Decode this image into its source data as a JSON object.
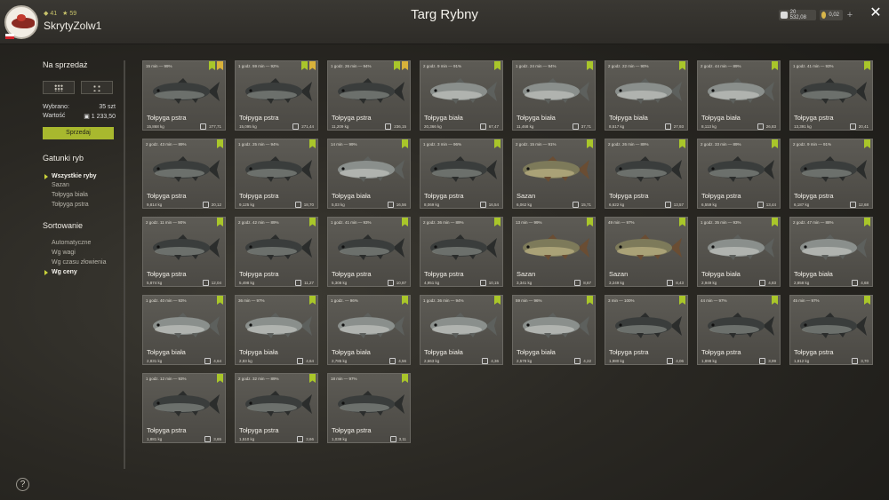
{
  "header": {
    "title": "Targ Rybny",
    "username": "SkrytyZolw1",
    "stat_level": "41",
    "stat_stars": "59",
    "silver": "20 532,08",
    "gold": "0,02",
    "plus": "+",
    "close": "✕"
  },
  "sidebar": {
    "sale_title": "Na sprzedaż",
    "selected_label": "Wybrano:",
    "selected_value": "35 szt",
    "value_label": "Wartość",
    "value_value": "1 233,50",
    "sell_button": "Sprzedaj",
    "species_title": "Gatunki ryb",
    "species": [
      "Wszystkie ryby",
      "Sazan",
      "Tołpyga biała",
      "Tołpyga pstra"
    ],
    "sorting_title": "Sortowanie",
    "sorting": [
      "Automatyczne",
      "Wg wagi",
      "Wg czasu złowienia",
      "Wg ceny"
    ],
    "help": "?"
  },
  "colors": {
    "accent": "#a8b82e",
    "ribbon_green": "#a9c62a",
    "ribbon_gold": "#d9b23a"
  },
  "fish": [
    {
      "time": "15 min — 99%",
      "name": "Tołpyga pstra",
      "weight": "15,868 kg",
      "price": "277,71",
      "ribbons": [
        "green",
        "gold"
      ],
      "kind": "pstra"
    },
    {
      "time": "1 godz. 59 min — 92%",
      "name": "Tołpyga pstra",
      "weight": "15,095 kg",
      "price": "271,44",
      "ribbons": [
        "green",
        "gold"
      ],
      "kind": "pstra"
    },
    {
      "time": "1 godz. 26 min — 94%",
      "name": "Tołpyga pstra",
      "weight": "11,209 kg",
      "price": "236,15",
      "ribbons": [
        "green",
        "gold"
      ],
      "kind": "pstra"
    },
    {
      "time": "2 godz. 9 min — 91%",
      "name": "Tołpyga biała",
      "weight": "20,366 kg",
      "price": "67,47",
      "ribbons": [
        "green"
      ],
      "kind": "biala"
    },
    {
      "time": "1 godz. 24 min — 94%",
      "name": "Tołpyga biała",
      "weight": "11,468 kg",
      "price": "37,71",
      "ribbons": [
        "green"
      ],
      "kind": "biala"
    },
    {
      "time": "2 godz. 22 min — 90%",
      "name": "Tołpyga biała",
      "weight": "8,517 kg",
      "price": "27,93",
      "ribbons": [
        "green"
      ],
      "kind": "biala"
    },
    {
      "time": "2 godz. 44 min — 89%",
      "name": "Tołpyga biała",
      "weight": "8,113 kg",
      "price": "26,83",
      "ribbons": [
        "green"
      ],
      "kind": "biala"
    },
    {
      "time": "1 godz. 41 min — 93%",
      "name": "Tołpyga pstra",
      "weight": "13,391 kg",
      "price": "20,41",
      "ribbons": [
        "green"
      ],
      "kind": "pstra"
    },
    {
      "time": "2 godz. 43 min — 89%",
      "name": "Tołpyga pstra",
      "weight": "9,814 kg",
      "price": "20,12",
      "ribbons": [
        "green"
      ],
      "kind": "pstra"
    },
    {
      "time": "1 godz. 25 min — 94%",
      "name": "Tołpyga pstra",
      "weight": "9,125 kg",
      "price": "18,70",
      "ribbons": [
        "green"
      ],
      "kind": "pstra"
    },
    {
      "time": "14 min — 99%",
      "name": "Tołpyga biała",
      "weight": "5,03 kg",
      "price": "16,56",
      "ribbons": [
        "green"
      ],
      "kind": "biala"
    },
    {
      "time": "1 godz. 3 min — 96%",
      "name": "Tołpyga pstra",
      "weight": "8,069 kg",
      "price": "16,54",
      "ribbons": [
        "green"
      ],
      "kind": "pstra"
    },
    {
      "time": "2 godz. 15 min — 91%",
      "name": "Sazan",
      "weight": "6,062 kg",
      "price": "15,71",
      "ribbons": [
        "green"
      ],
      "kind": "sazan"
    },
    {
      "time": "2 godz. 26 min — 89%",
      "name": "Tołpyga pstra",
      "weight": "6,622 kg",
      "price": "13,57",
      "ribbons": [
        "green"
      ],
      "kind": "pstra"
    },
    {
      "time": "2 godz. 33 min — 89%",
      "name": "Tołpyga pstra",
      "weight": "6,559 kg",
      "price": "13,44",
      "ribbons": [
        "green"
      ],
      "kind": "pstra"
    },
    {
      "time": "2 godz. 9 min — 91%",
      "name": "Tołpyga pstra",
      "weight": "6,187 kg",
      "price": "12,68",
      "ribbons": [
        "green"
      ],
      "kind": "pstra"
    },
    {
      "time": "2 godz. 11 min — 90%",
      "name": "Tołpyga pstra",
      "weight": "5,874 kg",
      "price": "12,04",
      "ribbons": [
        "green"
      ],
      "kind": "pstra"
    },
    {
      "time": "2 godz. 42 min — 89%",
      "name": "Tołpyga pstra",
      "weight": "5,498 kg",
      "price": "11,27",
      "ribbons": [
        "green"
      ],
      "kind": "pstra"
    },
    {
      "time": "1 godz. 41 min — 93%",
      "name": "Tołpyga pstra",
      "weight": "5,308 kg",
      "price": "10,87",
      "ribbons": [
        "green"
      ],
      "kind": "pstra"
    },
    {
      "time": "2 godz. 36 min — 89%",
      "name": "Tołpyga pstra",
      "weight": "4,951 kg",
      "price": "10,15",
      "ribbons": [
        "green"
      ],
      "kind": "pstra"
    },
    {
      "time": "13 min — 99%",
      "name": "Sazan",
      "weight": "3,341 kg",
      "price": "8,67",
      "ribbons": [
        "green"
      ],
      "kind": "sazan"
    },
    {
      "time": "49 min — 97%",
      "name": "Sazan",
      "weight": "3,249 kg",
      "price": "8,43",
      "ribbons": [
        "green"
      ],
      "kind": "sazan"
    },
    {
      "time": "1 godz. 35 min — 93%",
      "name": "Tołpyga biała",
      "weight": "2,949 kg",
      "price": "4,83",
      "ribbons": [
        "green"
      ],
      "kind": "biala"
    },
    {
      "time": "2 godz. 47 min — 88%",
      "name": "Tołpyga biała",
      "weight": "2,858 kg",
      "price": "4,68",
      "ribbons": [
        "green"
      ],
      "kind": "biala"
    },
    {
      "time": "1 godz. 40 min — 93%",
      "name": "Tołpyga biała",
      "weight": "2,831 kg",
      "price": "4,64",
      "ribbons": [
        "green"
      ],
      "kind": "biala"
    },
    {
      "time": "36 min — 97%",
      "name": "Tołpyga biała",
      "weight": "2,83 kg",
      "price": "4,64",
      "ribbons": [
        "green"
      ],
      "kind": "biala"
    },
    {
      "time": "1 godz. — 96%",
      "name": "Tołpyga biała",
      "weight": "2,785 kg",
      "price": "4,56",
      "ribbons": [
        "green"
      ],
      "kind": "biala"
    },
    {
      "time": "1 godz. 36 min — 94%",
      "name": "Tołpyga biała",
      "weight": "2,663 kg",
      "price": "4,36",
      "ribbons": [
        "green"
      ],
      "kind": "biala"
    },
    {
      "time": "59 min — 96%",
      "name": "Tołpyga biała",
      "weight": "2,578 kg",
      "price": "4,22",
      "ribbons": [
        "green"
      ],
      "kind": "biala"
    },
    {
      "time": "3 min — 100%",
      "name": "Tołpyga pstra",
      "weight": "1,980 kg",
      "price": "4,06",
      "ribbons": [
        "green"
      ],
      "kind": "pstra"
    },
    {
      "time": "44 min — 97%",
      "name": "Tołpyga pstra",
      "weight": "1,898 kg",
      "price": "3,99",
      "ribbons": [
        "green"
      ],
      "kind": "pstra"
    },
    {
      "time": "45 min — 97%",
      "name": "Tołpyga pstra",
      "weight": "1,812 kg",
      "price": "3,70",
      "ribbons": [
        "green"
      ],
      "kind": "pstra"
    },
    {
      "time": "1 godz. 12 min — 93%",
      "name": "Tołpyga pstra",
      "weight": "1,881 kg",
      "price": "3,65",
      "ribbons": [
        "green"
      ],
      "kind": "pstra"
    },
    {
      "time": "2 godz. 32 min — 89%",
      "name": "Tołpyga pstra",
      "weight": "1,510 kg",
      "price": "3,66",
      "ribbons": [
        "green"
      ],
      "kind": "pstra"
    },
    {
      "time": "18 min — 97%",
      "name": "Tołpyga pstra",
      "weight": "1,038 kg",
      "price": "3,11",
      "ribbons": [
        "green"
      ],
      "kind": "pstra"
    }
  ]
}
